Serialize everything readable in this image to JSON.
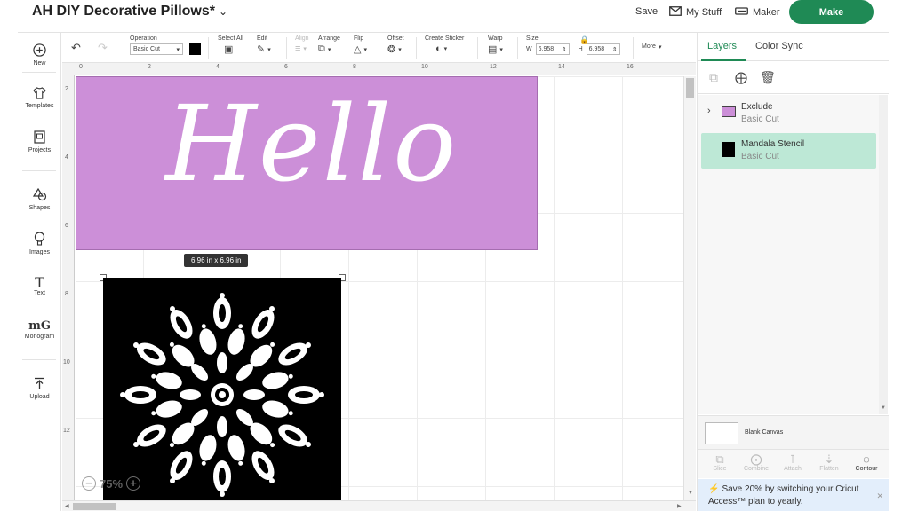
{
  "header": {
    "title": "AH DIY Decorative Pillows*",
    "save_label": "Save",
    "mystuff_label": "My Stuff",
    "maker_label": "Maker",
    "make_label": "Make"
  },
  "sidebar": {
    "items": [
      {
        "label": "New",
        "icon": "plus-circle-icon"
      },
      {
        "label": "Templates",
        "icon": "tshirt-icon"
      },
      {
        "label": "Projects",
        "icon": "project-icon"
      },
      {
        "label": "Shapes",
        "icon": "shapes-icon"
      },
      {
        "label": "Images",
        "icon": "bulb-icon"
      },
      {
        "label": "Text",
        "icon": "text-icon"
      },
      {
        "label": "Monogram",
        "icon": "monogram-icon"
      },
      {
        "label": "Upload",
        "icon": "upload-icon"
      }
    ]
  },
  "toolbar": {
    "operation_label": "Operation",
    "operation_value": "Basic Cut",
    "select_all_label": "Select All",
    "edit_label": "Edit",
    "align_label": "Align",
    "arrange_label": "Arrange",
    "flip_label": "Flip",
    "offset_label": "Offset",
    "create_sticker_label": "Create Sticker",
    "warp_label": "Warp",
    "size_label": "Size",
    "w_label": "W",
    "w_value": "6.958",
    "h_label": "H",
    "h_value": "6.958",
    "more_label": "More"
  },
  "rulers": {
    "top": [
      "0",
      "2",
      "4",
      "6",
      "8",
      "10",
      "12",
      "14",
      "16"
    ],
    "left": [
      "2",
      "4",
      "6",
      "8",
      "10",
      "12"
    ]
  },
  "canvas": {
    "hello_text": "Hello",
    "size_badge": "6.96  in x 6.96  in",
    "zoom_value": "75%",
    "hello_fill": "#cc8fd8"
  },
  "panel": {
    "tab_layers": "Layers",
    "tab_color_sync": "Color Sync",
    "layers": [
      {
        "name": "Exclude",
        "operation": "Basic Cut"
      },
      {
        "name": "Mandala Stencil",
        "operation": "Basic Cut"
      }
    ],
    "blank_canvas_label": "Blank Canvas",
    "bottom_tools": [
      "Slice",
      "Combine",
      "Attach",
      "Flatten",
      "Contour"
    ],
    "promo_text": "Save 20% by switching your Cricut Access™ plan to yearly."
  },
  "colors": {
    "accent": "#1f8a55",
    "selected_layer": "#bde8d6",
    "promo_bg": "#e3eefb"
  }
}
